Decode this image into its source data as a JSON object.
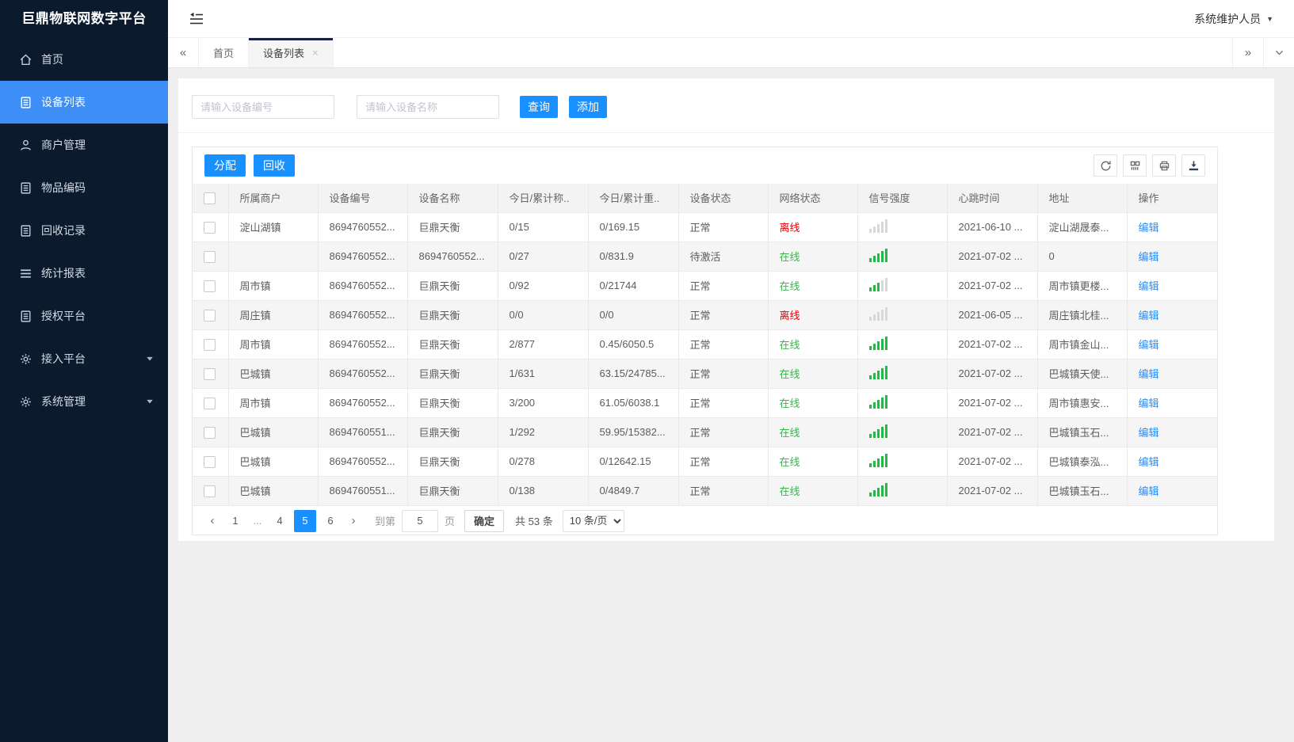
{
  "colors": {
    "accent": "#1890ff",
    "sidebar_active": "#3e8ef7",
    "online": "#39b54a",
    "offline": "#e60000",
    "link": "#2d8cf0",
    "signal_on": "#21ba45",
    "signal_off": "#d8d8d8"
  },
  "app": {
    "title": "巨鼎物联网数字平台",
    "user": "系统维护人员"
  },
  "sidebar": {
    "items": [
      {
        "key": "home",
        "label": "首页",
        "icon": "home",
        "active": false,
        "expandable": false
      },
      {
        "key": "device-list",
        "label": "设备列表",
        "icon": "doc",
        "active": true,
        "expandable": false
      },
      {
        "key": "merchant",
        "label": "商户管理",
        "icon": "user",
        "active": false,
        "expandable": false
      },
      {
        "key": "item-code",
        "label": "物品编码",
        "icon": "doc",
        "active": false,
        "expandable": false
      },
      {
        "key": "recycle-record",
        "label": "回收记录",
        "icon": "doc",
        "active": false,
        "expandable": false
      },
      {
        "key": "report",
        "label": "统计报表",
        "icon": "lines",
        "active": false,
        "expandable": false
      },
      {
        "key": "auth-platform",
        "label": "授权平台",
        "icon": "doc",
        "active": false,
        "expandable": false
      },
      {
        "key": "access-platform",
        "label": "接入平台",
        "icon": "gear",
        "active": false,
        "expandable": true
      },
      {
        "key": "system-manage",
        "label": "系统管理",
        "icon": "gear",
        "active": false,
        "expandable": true
      }
    ]
  },
  "tabs": {
    "items": [
      {
        "key": "home",
        "label": "首页",
        "active": false,
        "closable": false
      },
      {
        "key": "device-list",
        "label": "设备列表",
        "active": true,
        "closable": true
      }
    ]
  },
  "search": {
    "device_no_placeholder": "请输入设备编号",
    "device_name_placeholder": "请输入设备名称",
    "query_label": "查询",
    "add_label": "添加"
  },
  "toolbar": {
    "assign_label": "分配",
    "recycle_label": "回收"
  },
  "table": {
    "headers": [
      "所属商户",
      "设备编号",
      "设备名称",
      "今日/累计称..",
      "今日/累计重..",
      "设备状态",
      "网络状态",
      "信号强度",
      "心跳时间",
      "地址",
      "操作"
    ],
    "edit_label": "编辑",
    "rows": [
      {
        "merchant": "淀山湖镇",
        "device_no": "8694760552...",
        "device_name": "巨鼎天衡",
        "count": "0/15",
        "weight": "0/169.15",
        "status": "正常",
        "network": "离线",
        "online": false,
        "signal": 0,
        "heartbeat": "2021-06-10 ...",
        "address": "淀山湖晟泰..."
      },
      {
        "merchant": "",
        "device_no": "8694760552...",
        "device_name": "8694760552...",
        "count": "0/27",
        "weight": "0/831.9",
        "status": "待激活",
        "network": "在线",
        "online": true,
        "signal": 5,
        "heartbeat": "2021-07-02 ...",
        "address": "0"
      },
      {
        "merchant": "周市镇",
        "device_no": "8694760552...",
        "device_name": "巨鼎天衡",
        "count": "0/92",
        "weight": "0/21744",
        "status": "正常",
        "network": "在线",
        "online": true,
        "signal": 3,
        "heartbeat": "2021-07-02 ...",
        "address": "周市镇更楼..."
      },
      {
        "merchant": "周庄镇",
        "device_no": "8694760552...",
        "device_name": "巨鼎天衡",
        "count": "0/0",
        "weight": "0/0",
        "status": "正常",
        "network": "离线",
        "online": false,
        "signal": 0,
        "heartbeat": "2021-06-05 ...",
        "address": "周庄镇北桂..."
      },
      {
        "merchant": "周市镇",
        "device_no": "8694760552...",
        "device_name": "巨鼎天衡",
        "count": "2/877",
        "weight": "0.45/6050.5",
        "status": "正常",
        "network": "在线",
        "online": true,
        "signal": 5,
        "heartbeat": "2021-07-02 ...",
        "address": "周市镇金山..."
      },
      {
        "merchant": "巴城镇",
        "device_no": "8694760552...",
        "device_name": "巨鼎天衡",
        "count": "1/631",
        "weight": "63.15/24785...",
        "status": "正常",
        "network": "在线",
        "online": true,
        "signal": 5,
        "heartbeat": "2021-07-02 ...",
        "address": "巴城镇天使..."
      },
      {
        "merchant": "周市镇",
        "device_no": "8694760552...",
        "device_name": "巨鼎天衡",
        "count": "3/200",
        "weight": "61.05/6038.1",
        "status": "正常",
        "network": "在线",
        "online": true,
        "signal": 5,
        "heartbeat": "2021-07-02 ...",
        "address": "周市镇惠安..."
      },
      {
        "merchant": "巴城镇",
        "device_no": "8694760551...",
        "device_name": "巨鼎天衡",
        "count": "1/292",
        "weight": "59.95/15382...",
        "status": "正常",
        "network": "在线",
        "online": true,
        "signal": 5,
        "heartbeat": "2021-07-02 ...",
        "address": "巴城镇玉石..."
      },
      {
        "merchant": "巴城镇",
        "device_no": "8694760552...",
        "device_name": "巨鼎天衡",
        "count": "0/278",
        "weight": "0/12642.15",
        "status": "正常",
        "network": "在线",
        "online": true,
        "signal": 5,
        "heartbeat": "2021-07-02 ...",
        "address": "巴城镇泰泓..."
      },
      {
        "merchant": "巴城镇",
        "device_no": "8694760551...",
        "device_name": "巨鼎天衡",
        "count": "0/138",
        "weight": "0/4849.7",
        "status": "正常",
        "network": "在线",
        "online": true,
        "signal": 5,
        "heartbeat": "2021-07-02 ...",
        "address": "巴城镇玉石..."
      }
    ]
  },
  "pagination": {
    "pages": [
      {
        "label": "1",
        "active": false
      },
      {
        "label": "...",
        "active": false,
        "ellipsis": true
      },
      {
        "label": "4",
        "active": false
      },
      {
        "label": "5",
        "active": true
      },
      {
        "label": "6",
        "active": false
      }
    ],
    "goto_label": "到第",
    "goto_value": "5",
    "page_unit": "页",
    "confirm_label": "确定",
    "total_label": "共 53 条",
    "page_size_label": "10 条/页"
  }
}
